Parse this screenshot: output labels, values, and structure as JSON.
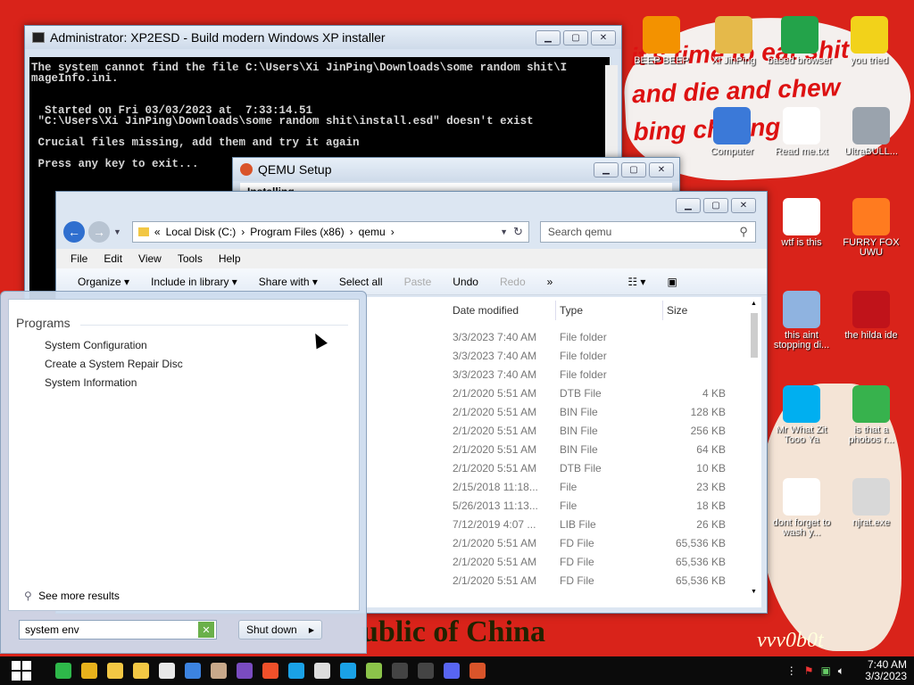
{
  "wallpaper": {
    "top_text": "it's time to eat shit and die and chew bing chilling",
    "bottom_text": "ublic of China",
    "signature": "vvv0b0t"
  },
  "desktop_icons": [
    {
      "label": "BEEP BEEP",
      "icon": "vlc-icon",
      "color": "#f39200"
    },
    {
      "label": "Xi JinPing",
      "icon": "user-folder-icon",
      "color": "#e5b94a"
    },
    {
      "label": "based browser",
      "icon": "chat-icon",
      "color": "#23a34a"
    },
    {
      "label": "you tried",
      "icon": "star-icon",
      "color": "#f2d21a"
    },
    {
      "label": "Computer",
      "icon": "computer-icon",
      "color": "#3b79d8"
    },
    {
      "label": "Read me.txt",
      "icon": "text-file-icon",
      "color": "#ffffff"
    },
    {
      "label": "UltraBULL...",
      "icon": "disc-icon",
      "color": "#9aa3ad"
    },
    {
      "label": "wtf is this",
      "icon": "ini-file-icon",
      "color": "#ffffff"
    },
    {
      "label": "FURRY FOX UWU",
      "icon": "firefox-icon",
      "color": "#ff7b1f"
    },
    {
      "label": "this aint stopping di...",
      "icon": "setup-icon",
      "color": "#8fb3e0"
    },
    {
      "label": "the hilda ide",
      "icon": "devcpp-icon",
      "color": "#c0131a"
    },
    {
      "label": "Mr What Zit Tooo Ya",
      "icon": "skype-icon",
      "color": "#00aff0"
    },
    {
      "label": "is that a phobos r...",
      "icon": "icq-icon",
      "color": "#37b24d"
    },
    {
      "label": "dont forget to wash y...",
      "icon": "ini-file-icon",
      "color": "#ffffff"
    },
    {
      "label": "njrat.exe",
      "icon": "skull-icon",
      "color": "#d8d8d8"
    }
  ],
  "cmd_window": {
    "title": "Administrator:  XP2ESD - Build modern Windows XP installer",
    "console_text": "The system cannot find the file C:\\Users\\Xi JinPing\\Downloads\\some random shit\\I\nmageInfo.ini.\n\n\n  Started on Fri 03/03/2023 at  7:33:14.51\n \"C:\\Users\\Xi JinPing\\Downloads\\some random shit\\install.esd\" doesn't exist\n\n Crucial files missing, add them and try it again\n\n Press any key to exit..."
  },
  "qemu_window": {
    "title": "QEMU Setup",
    "body_text": "Installing"
  },
  "explorer": {
    "breadcrumb": [
      "Local Disk (C:)",
      "Program Files (x86)",
      "qemu"
    ],
    "breadcrumb_prefix": "«",
    "search_placeholder": "Search qemu",
    "menu": [
      "File",
      "Edit",
      "View",
      "Tools",
      "Help"
    ],
    "toolbar": {
      "organize": "Organize",
      "include": "Include in library",
      "share": "Share with",
      "select_all": "Select all",
      "paste": "Paste",
      "undo": "Undo",
      "redo": "Redo",
      "more": "»"
    },
    "columns": [
      "Date modified",
      "Type",
      "Size"
    ],
    "rows": [
      {
        "date": "3/3/2023 7:40 AM",
        "type": "File folder",
        "size": ""
      },
      {
        "date": "3/3/2023 7:40 AM",
        "type": "File folder",
        "size": ""
      },
      {
        "date": "3/3/2023 7:40 AM",
        "type": "File folder",
        "size": ""
      },
      {
        "date": "2/1/2020 5:51 AM",
        "type": "DTB File",
        "size": "4 KB"
      },
      {
        "date": "2/1/2020 5:51 AM",
        "type": "BIN File",
        "size": "128 KB"
      },
      {
        "date": "2/1/2020 5:51 AM",
        "type": "BIN File",
        "size": "256 KB"
      },
      {
        "date": "2/1/2020 5:51 AM",
        "type": "BIN File",
        "size": "64 KB"
      },
      {
        "date": "2/1/2020 5:51 AM",
        "type": "DTB File",
        "size": "10 KB"
      },
      {
        "date": "2/15/2018 11:18...",
        "type": "File",
        "size": "23 KB"
      },
      {
        "date": "5/26/2013 11:13...",
        "type": "File",
        "size": "18 KB"
      },
      {
        "date": "7/12/2019 4:07 ...",
        "type": "LIB File",
        "size": "26 KB"
      },
      {
        "date": "2/1/2020 5:51 AM",
        "type": "FD File",
        "size": "65,536 KB"
      },
      {
        "date": "2/1/2020 5:51 AM",
        "type": "FD File",
        "size": "65,536 KB"
      },
      {
        "date": "2/1/2020 5:51 AM",
        "type": "FD File",
        "size": "65,536 KB"
      }
    ]
  },
  "start_menu": {
    "section": "Programs",
    "items": [
      "System Configuration",
      "Create a System Repair Disc",
      "System Information"
    ],
    "see_more": "See more results",
    "search_value": "system env",
    "shutdown": "Shut down"
  },
  "taskbar": {
    "time": "7:40 AM",
    "date": "3/3/2023",
    "apps": [
      {
        "name": "chat-app-icon",
        "color": "#2eb84a"
      },
      {
        "name": "chrome-icon",
        "color": "#e8b21c"
      },
      {
        "name": "folder-icon",
        "color": "#f2c744"
      },
      {
        "name": "folder-icon",
        "color": "#f2c744"
      },
      {
        "name": "calendar-icon",
        "color": "#e8e8e8"
      },
      {
        "name": "calculator-icon",
        "color": "#3c83e0"
      },
      {
        "name": "paint-icon",
        "color": "#c8a88a"
      },
      {
        "name": "z-app-icon",
        "color": "#7a4cc0"
      },
      {
        "name": "brave-icon",
        "color": "#f0502a"
      },
      {
        "name": "media-icon",
        "color": "#1aa1e6"
      },
      {
        "name": "7zip-icon",
        "color": "#dddddd"
      },
      {
        "name": "remote-icon",
        "color": "#1aa1e6"
      },
      {
        "name": "notepad-icon",
        "color": "#8bc34a"
      },
      {
        "name": "cmd-icon",
        "color": "#444444"
      },
      {
        "name": "cmd-icon",
        "color": "#444444"
      },
      {
        "name": "discord-icon",
        "color": "#5865f2"
      },
      {
        "name": "qemu-icon",
        "color": "#d9542a"
      }
    ]
  }
}
